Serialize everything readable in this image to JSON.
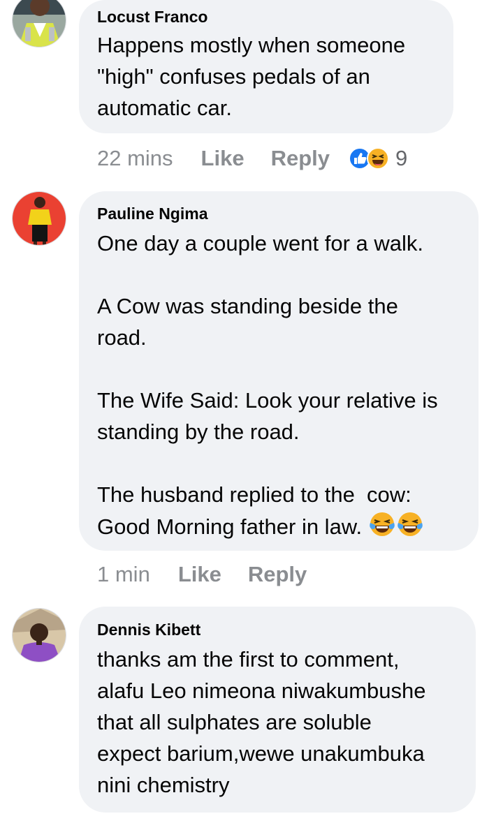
{
  "comments": [
    {
      "author": "Locust Franco",
      "text": "Happens mostly when someone\n\"high\" confuses pedals of an\nautomatic car.",
      "time": "22 mins",
      "like_label": "Like",
      "reply_label": "Reply",
      "reactions": {
        "icons": [
          "like-icon",
          "haha-icon"
        ],
        "count": "9"
      }
    },
    {
      "author": "Pauline Ngima",
      "text": "One day a couple went for a walk.\n\nA Cow was standing beside the\nroad.\n\nThe Wife Said: Look your relative is\nstanding by the road.\n\nThe husband replied to the  cow:\nGood Morning father in law.",
      "emojis": [
        "laughing-tears-emoji",
        "laughing-tears-emoji"
      ],
      "time": "1 min",
      "like_label": "Like",
      "reply_label": "Reply"
    },
    {
      "author": "Dennis Kibett",
      "text": "thanks am the first to comment,\nalafu Leo nimeona niwakumbushe\nthat all sulphates are soluble\nexpect barium,wewe unakumbuka\nnini chemistry"
    }
  ],
  "colors": {
    "bubble": "#f0f2f5",
    "meta_text": "#8a8d91",
    "like_blue": "#1877f2",
    "haha_yellow": "#f7b125"
  }
}
